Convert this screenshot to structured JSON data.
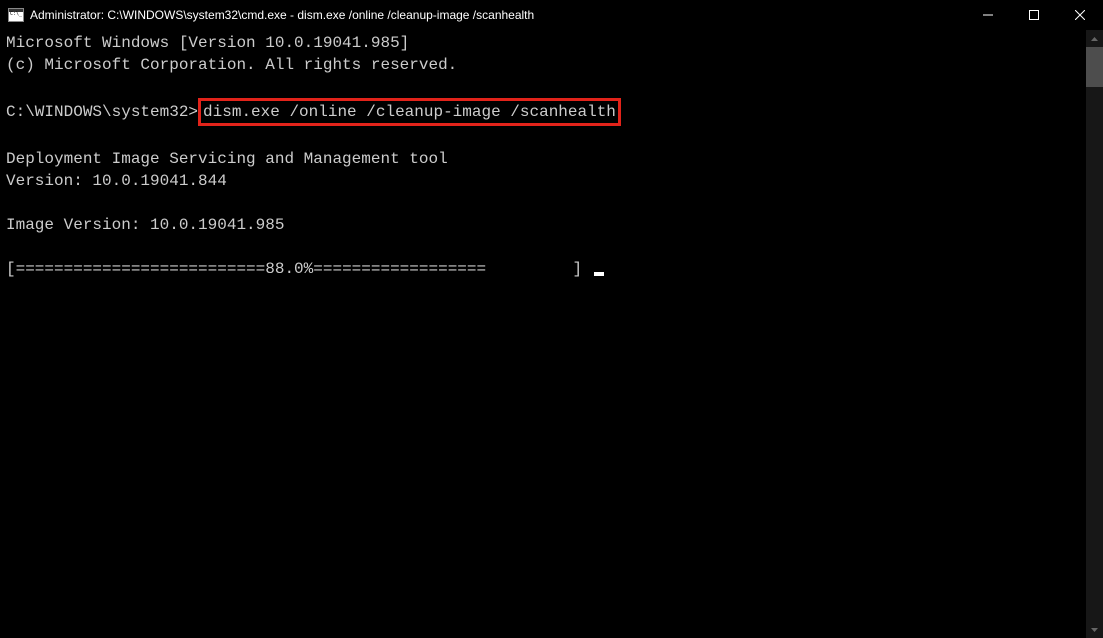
{
  "window": {
    "title": "Administrator: C:\\WINDOWS\\system32\\cmd.exe - dism.exe  /online /cleanup-image /scanhealth"
  },
  "terminal": {
    "line1": "Microsoft Windows [Version 10.0.19041.985]",
    "line2": "(c) Microsoft Corporation. All rights reserved.",
    "prompt": "C:\\WINDOWS\\system32>",
    "command": "dism.exe /online /cleanup-image /scanhealth",
    "tool_line": "Deployment Image Servicing and Management tool",
    "version_line": "Version: 10.0.19041.844",
    "image_version_line": "Image Version: 10.0.19041.985",
    "progress_left": "[==========================",
    "progress_pct": "88.0%",
    "progress_right": "==================         ] "
  }
}
